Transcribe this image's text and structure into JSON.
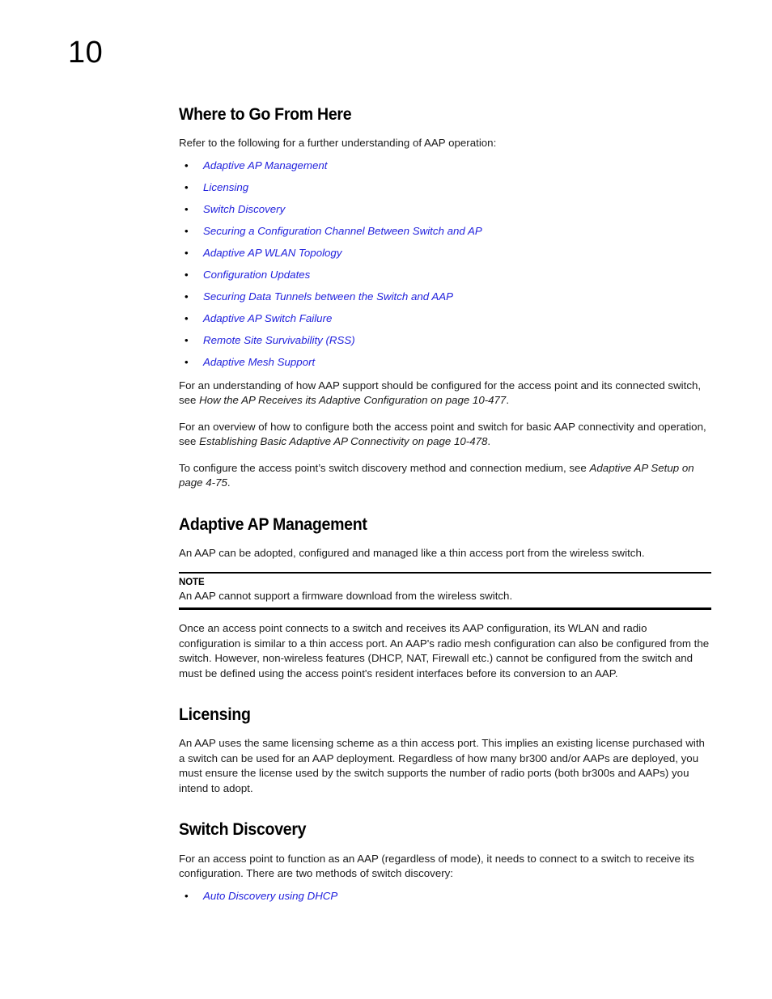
{
  "page": {
    "chapter_number": "10"
  },
  "sections": {
    "where_to_go": {
      "heading": "Where to Go From Here",
      "intro": "Refer to the following for a further understanding of AAP operation:",
      "links": [
        "Adaptive AP Management",
        "Licensing",
        "Switch Discovery",
        "Securing a Configuration Channel Between Switch and AP",
        "Adaptive AP WLAN Topology",
        "Configuration Updates",
        "Securing Data Tunnels between the Switch and AAP",
        "Adaptive AP Switch Failure",
        "Remote Site Survivability (RSS)",
        "Adaptive Mesh Support"
      ],
      "paragraphs": [
        {
          "pre": "For an understanding of how AAP support should be configured for the access point and its connected switch, see ",
          "xref": "How the AP Receives its Adaptive Configuration on page 10-477",
          "post": "."
        },
        {
          "pre": "For an overview of how to configure both the access point and switch for basic AAP connectivity and operation, see ",
          "xref": "Establishing Basic Adaptive AP Connectivity on page 10-478",
          "post": "."
        },
        {
          "pre": "To configure the access point’s switch discovery method and connection medium, see ",
          "xref": "Adaptive AP Setup on page 4-75",
          "post": "."
        }
      ]
    },
    "adaptive_ap_management": {
      "heading": "Adaptive AP Management",
      "intro": "An AAP can be adopted, configured and managed like a thin access port from the wireless switch.",
      "note": {
        "label": "NOTE",
        "text": "An AAP cannot support a firmware download from the wireless switch."
      },
      "body": "Once an access point connects to a switch and receives its AAP configuration, its WLAN and radio configuration is similar to a thin access port. An AAP's radio mesh configuration can also be configured from the switch. However, non-wireless features (DHCP, NAT, Firewall etc.) cannot be configured from the switch and must be defined using the access point's resident interfaces before its conversion to an AAP."
    },
    "licensing": {
      "heading": "Licensing",
      "body": "An AAP uses the same licensing scheme as a thin access port. This implies an existing license purchased with a switch can be used for an AAP deployment. Regardless of how many br300 and/or AAPs are deployed, you must ensure the license used by the switch supports the number of radio ports (both br300s and AAPs) you intend to adopt."
    },
    "switch_discovery": {
      "heading": "Switch Discovery",
      "body": "For an access point to function as an AAP (regardless of mode), it needs to connect to a switch to receive its configuration. There are two methods of switch discovery:",
      "links": [
        "Auto Discovery using DHCP"
      ]
    }
  },
  "icons": {
    "bullet": "•"
  },
  "colors": {
    "link": "#2222dd",
    "text": "#1a1a1a",
    "rule": "#000000"
  }
}
